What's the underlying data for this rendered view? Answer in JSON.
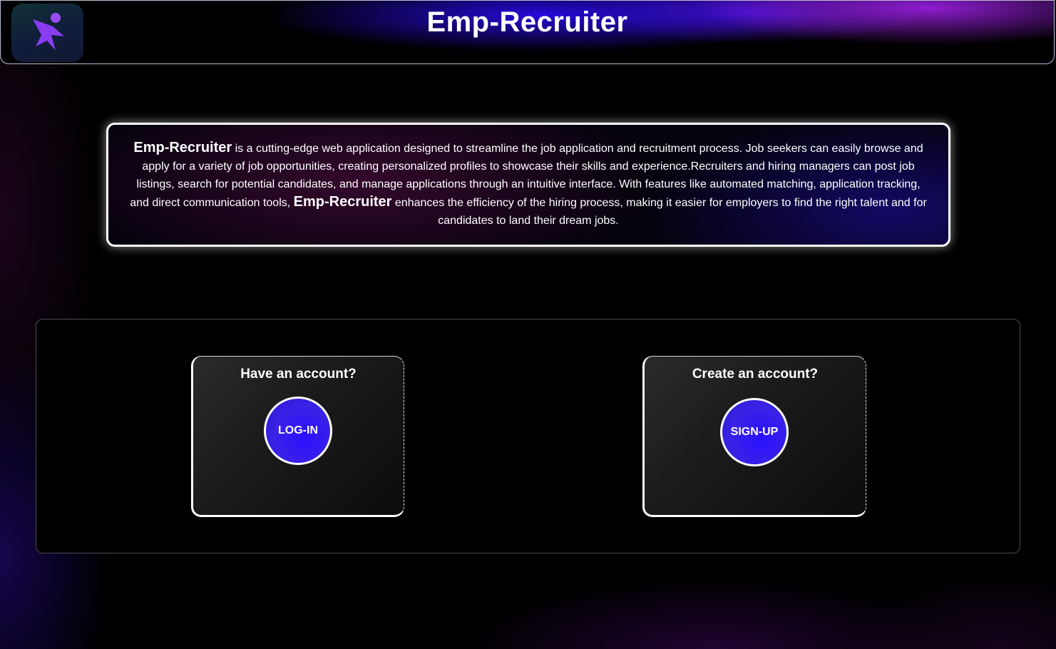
{
  "app": {
    "title": "Emp-Recruiter",
    "logo_icon": "runner-logo-icon"
  },
  "about": {
    "brand": "Emp-Recruiter",
    "text_part1": " is a cutting-edge web application designed to streamline the job application and recruitment process. Job seekers can easily browse and apply for a variety of job opportunities, creating personalized profiles to showcase their skills and experience.Recruiters and hiring managers can post job listings, search for potential candidates, and manage applications through an intuitive interface. With features like automated matching, application tracking, and direct communication tools, ",
    "brand2": "Emp-Recruiter",
    "text_part2": " enhances the efficiency of the hiring process, making it easier for employers to find the right talent and for candidates to land their dream jobs."
  },
  "login_card": {
    "title": "Have an account?",
    "button_label": "LOG-IN"
  },
  "signup_card": {
    "title": "Create an account?",
    "button_label": "SIGN-UP"
  },
  "colors": {
    "header_gradient_primary": "#2a0ae6",
    "header_gradient_accent": "#9620dc",
    "button_fill": "#2a10ff",
    "logo_mark": "#8a3df0"
  }
}
